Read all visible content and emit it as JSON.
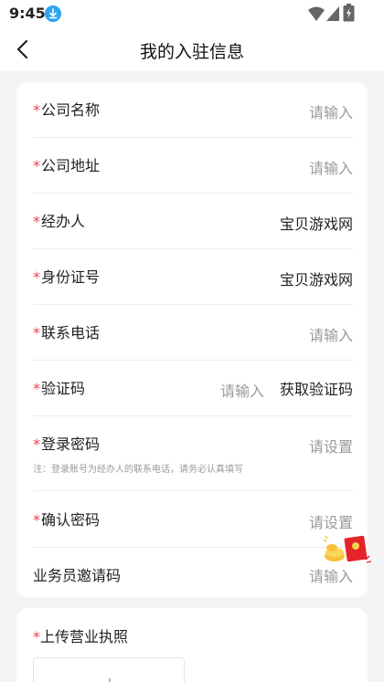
{
  "status_bar": {
    "time": "9:45"
  },
  "nav": {
    "title": "我的入驻信息"
  },
  "form": {
    "required_mark": "*",
    "company_name": {
      "label": "公司名称",
      "placeholder": "请输入"
    },
    "company_address": {
      "label": "公司地址",
      "placeholder": "请输入"
    },
    "handler": {
      "label": "经办人",
      "value": "宝贝游戏网"
    },
    "id_number": {
      "label": "身份证号",
      "value": "宝贝游戏网"
    },
    "phone": {
      "label": "联系电话",
      "placeholder": "请输入"
    },
    "verify_code": {
      "label": "验证码",
      "placeholder": "请输入",
      "button": "获取验证码"
    },
    "login_password": {
      "label": "登录密码",
      "placeholder": "请设置",
      "note": "注：登录账号为经办人的联系电话，请务必认真填写"
    },
    "confirm_password": {
      "label": "确认密码",
      "placeholder": "请设置"
    },
    "salesman_code": {
      "label": "业务员邀请码",
      "placeholder": "请输入"
    }
  },
  "upload": {
    "label": "上传营业执照"
  },
  "icons": {
    "download": "download-icon",
    "wifi": "wifi-icon",
    "signal": "signal-icon",
    "battery": "battery-icon",
    "back": "back-arrow-icon",
    "red_packet": "red-packet-icon"
  },
  "colors": {
    "required": "#e8454d",
    "placeholder": "#9a9a9a",
    "background": "#f4f4f6"
  }
}
